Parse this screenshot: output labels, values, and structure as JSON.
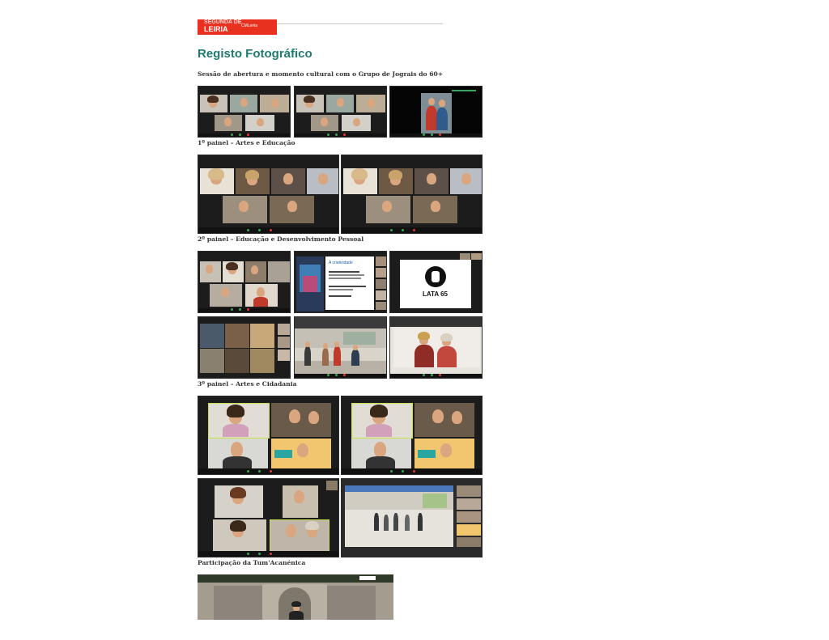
{
  "header": {
    "logo_line1": "SEGUNDA DE",
    "logo_line2": "LEIRIA",
    "logo_small": "CMLeiria"
  },
  "page_title": "Registo Fotográfico",
  "sections": [
    {
      "caption": "Sessão de abertura e momento cultural com o Grupo de Jograis do 60+"
    },
    {
      "caption": "1º painel – Artes e Educação"
    },
    {
      "caption": "2º painel – Educação e Desenvolvimento Pessoal"
    },
    {
      "caption": "3º painel – Artes e Cidadania"
    },
    {
      "caption": "Participação da Tum'Acanénica"
    }
  ],
  "slides": {
    "criatividade_title": "A criatividade",
    "lata_label": "LATA 65"
  },
  "colors": {
    "title": "#1f7a70",
    "caption": "#333333",
    "logo_red": "#e8311f",
    "call_dark": "#1c1c1c"
  }
}
